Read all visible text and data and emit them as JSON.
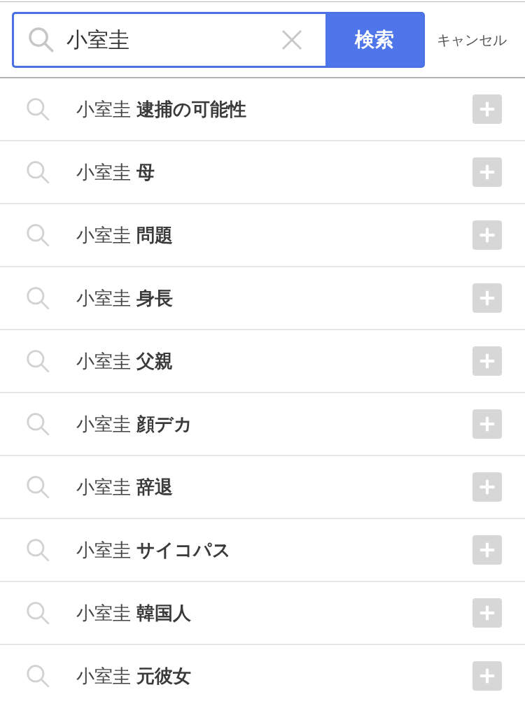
{
  "search": {
    "value": "小室圭",
    "focused": true,
    "button": "検索",
    "cancel": "キャンセル"
  },
  "suggestions": [
    {
      "text": "小室圭 **逮捕の可能性**"
    },
    {
      "text": "小室圭 **母**"
    },
    {
      "text": "小室圭 **問題**"
    },
    {
      "text": "小室圭 **身長**"
    },
    {
      "text": "小室圭 **父親**"
    },
    {
      "text": "小室圭 **顔デカ**"
    },
    {
      "text": "小室圭 **辞退**"
    },
    {
      "text": "小室圭 **サイコパス**"
    },
    {
      "text": "小室圭 **韓国人**"
    },
    {
      "text": "小室圭 **元彼女**"
    }
  ]
}
